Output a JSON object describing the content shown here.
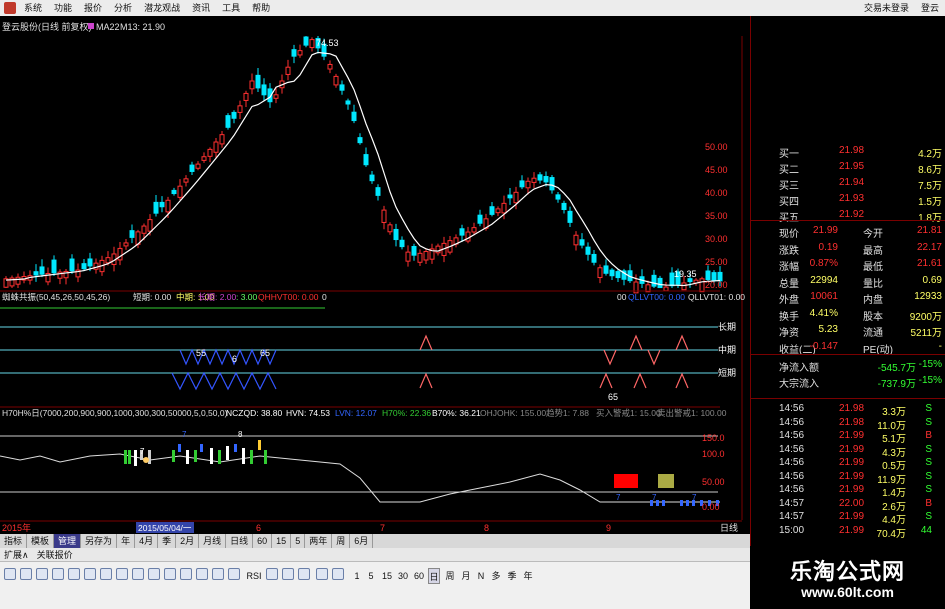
{
  "menubar": {
    "items": [
      "系统",
      "功能",
      "报价",
      "分析",
      "潜龙观战",
      "资讯",
      "工具",
      "帮助"
    ],
    "right": [
      "交易未登录",
      "登云"
    ]
  },
  "kline": {
    "title": "登云股份(日线 前复权)",
    "ma_label": "MA22",
    "ma_value_label": "M13: 21.90",
    "high_label": "74.53",
    "low_label": "19.35",
    "axis": [
      "50.00",
      "45.00",
      "40.00",
      "35.00",
      "30.00",
      "25.00",
      "20.00"
    ],
    "colors": {
      "up": "#ff3030",
      "down": "#00e8ff",
      "ma": "#ffffff"
    }
  },
  "indicator1": {
    "header": "蜘蛛共振(50,45,26,50,45,26)",
    "short_label": "短期: 0.00",
    "mid_label": "中期: 1.00",
    "long_label": "长期: 2.00",
    "val3": ": 3.00",
    "qh_label": "QHHVT00: 0.00",
    "extra": "0",
    "right_header_a": "00",
    "right_header_b": "QLLVT00: 0.00",
    "right_header_c": "QLLVT01: 0.00",
    "row_labels": [
      "长期",
      "中期",
      "短期"
    ],
    "nums": [
      "55",
      "6",
      "65",
      "65"
    ]
  },
  "indicator2": {
    "header": "H70H%日(7000,200,900,900,1000,300,300,50000,5,0,50,0)",
    "nczqd": "NCZQD: 38.80",
    "hvn": "HVN: 74.53",
    "lvn": "LVN: 12.07",
    "h70": "H70%: 22.36",
    "b70": "B70%: 36.21",
    "ohjohk": "OHJOHK: 155.00",
    "trend": "趋势1: 7.88",
    "buy": "买入警戒1: 15.00",
    "sell": "卖出警戒1: 100.00",
    "axis": [
      "150.0",
      "100.0",
      "50.00",
      "0.00"
    ],
    "marks": [
      "7",
      "8",
      "7",
      "7",
      "7",
      "7"
    ]
  },
  "timeline": {
    "year": "2015年",
    "cursor": "2015/05/04/一",
    "months": [
      "6",
      "7",
      "8",
      "9"
    ],
    "right_label": "日线"
  },
  "quote": {
    "levels": [
      {
        "label": "买一",
        "price": "21.98",
        "vol": "4.2万"
      },
      {
        "label": "买二",
        "price": "21.95",
        "vol": "8.6万"
      },
      {
        "label": "买三",
        "price": "21.94",
        "vol": "7.5万"
      },
      {
        "label": "买四",
        "price": "21.93",
        "vol": "1.5万"
      },
      {
        "label": "买五",
        "price": "21.92",
        "vol": "1.8万"
      }
    ],
    "stats": [
      {
        "l1": "现价",
        "v1": "21.99",
        "l2": "今开",
        "v2": "21.81"
      },
      {
        "l1": "涨跌",
        "v1": "0.19",
        "l2": "最高",
        "v2": "22.17"
      },
      {
        "l1": "涨幅",
        "v1": "0.87%",
        "l2": "最低",
        "v2": "21.61"
      },
      {
        "l1": "总量",
        "v1": "22994",
        "l2": "量比",
        "v2": "0.69"
      },
      {
        "l1": "外盘",
        "v1": "10061",
        "l2": "内盘",
        "v2": "12933"
      },
      {
        "l1": "换手",
        "v1": "4.41%",
        "l2": "股本",
        "v2": "9200万"
      },
      {
        "l1": "净资",
        "v1": "5.23",
        "l2": "流通",
        "v2": "5211万"
      },
      {
        "l1": "收益(二)",
        "v1": "-0.147",
        "l2": "PE(动)",
        "v2": "-"
      }
    ],
    "flows": [
      {
        "label": "净流入额",
        "v": "-545.7万",
        "p": "-15%"
      },
      {
        "label": "大宗流入",
        "v": "-737.9万",
        "p": "-15%"
      }
    ],
    "ticks": [
      {
        "t": "14:56",
        "p": "21.98",
        "v": "3.3万",
        "s": "S"
      },
      {
        "t": "14:56",
        "p": "21.98",
        "v": "11.0万",
        "s": "S"
      },
      {
        "t": "14:56",
        "p": "21.99",
        "v": "5.1万",
        "s": "B"
      },
      {
        "t": "14:56",
        "p": "21.99",
        "v": "4.3万",
        "s": "S"
      },
      {
        "t": "14:56",
        "p": "21.99",
        "v": "0.5万",
        "s": "S"
      },
      {
        "t": "14:56",
        "p": "21.99",
        "v": "11.9万",
        "s": "S"
      },
      {
        "t": "14:56",
        "p": "21.99",
        "v": "1.4万",
        "s": "S"
      },
      {
        "t": "14:57",
        "p": "22.00",
        "v": "2.6万",
        "s": "B"
      },
      {
        "t": "14:57",
        "p": "21.99",
        "v": "4.4万",
        "s": "S"
      },
      {
        "t": "15:00",
        "p": "21.99",
        "v": "70.4万",
        "s": "44"
      }
    ]
  },
  "tabs": [
    "指标",
    "模板",
    "管理",
    "另存为",
    "年",
    "4月",
    "季",
    "2月",
    "月线",
    "日线",
    "60",
    "15",
    "5",
    "两年",
    "周",
    "6月"
  ],
  "active_tab": "管理",
  "subtabs": [
    "扩展∧",
    "关联报价"
  ],
  "toolbar_labels": [
    "RSI",
    "1",
    "5",
    "15",
    "30",
    "60",
    "日",
    "周",
    "月",
    "N",
    "多",
    "季",
    "年"
  ],
  "watermark": {
    "title": "乐淘公式网",
    "url": "www.60lt.com"
  }
}
